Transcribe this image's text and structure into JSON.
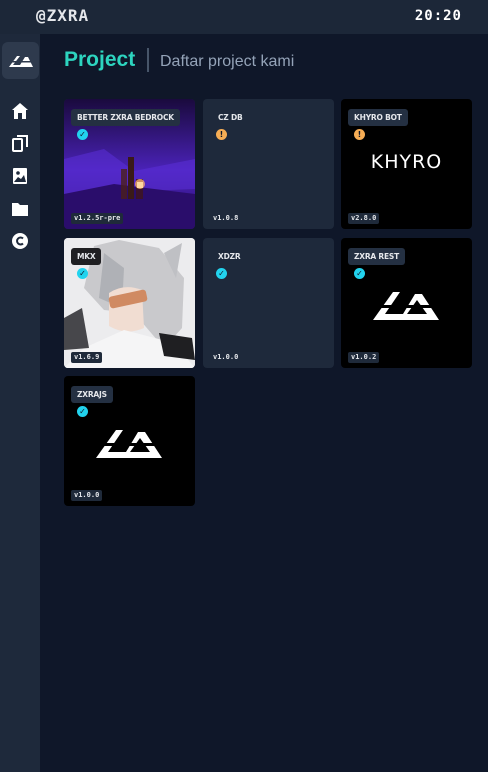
{
  "topbar": {
    "brand": "@ZXRA",
    "time": "20:20"
  },
  "header": {
    "title": "Project",
    "subtitle": "Daftar project kami"
  },
  "sidebar": {
    "items": [
      {
        "icon": "home-icon"
      },
      {
        "icon": "collection-icon"
      },
      {
        "icon": "image-icon"
      },
      {
        "icon": "folder-icon"
      },
      {
        "icon": "copyright-icon"
      }
    ]
  },
  "projects": [
    {
      "name": "BETTER ZXRA BEDROCK",
      "version": "v1.2.5r-pre",
      "status": "verified"
    },
    {
      "name": "CZ DB",
      "version": "v1.0.8",
      "status": "warning"
    },
    {
      "name": "KHYRO BOT",
      "version": "v2.8.0",
      "status": "warning",
      "logo_text": "KHYRO"
    },
    {
      "name": "MKX",
      "version": "v1.6.9",
      "status": "verified"
    },
    {
      "name": "XDZR",
      "version": "v1.0.0",
      "status": "verified"
    },
    {
      "name": "ZXRA REST",
      "version": "v1.0.2",
      "status": "verified"
    },
    {
      "name": "ZXRAJS",
      "version": "v1.0.0",
      "status": "verified"
    }
  ],
  "colors": {
    "accent": "#2dd4bf",
    "verified": "#22d3ee",
    "warning": "#f6ad55"
  }
}
